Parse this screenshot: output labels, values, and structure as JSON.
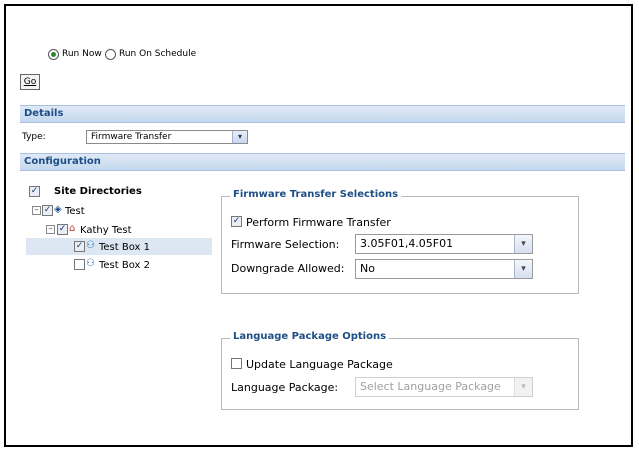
{
  "schedule": {
    "run_now": "Run Now",
    "run_on_schedule": "Run On Schedule",
    "selected": "run_now"
  },
  "go_button": "Go",
  "details": {
    "header": "Details",
    "type_label": "Type:",
    "type_value": "Firmware Transfer"
  },
  "configuration": {
    "header": "Configuration"
  },
  "tree": {
    "root": "Site Directories",
    "items": [
      {
        "label": "Test",
        "checked": true
      },
      {
        "label": "Kathy Test",
        "checked": true
      },
      {
        "label": "Test Box 1",
        "checked": true,
        "selected": true
      },
      {
        "label": "Test Box 2",
        "checked": false
      }
    ]
  },
  "firmware": {
    "legend": "Firmware Transfer Selections",
    "perform_label": "Perform Firmware Transfer",
    "perform_checked": true,
    "selection_label": "Firmware Selection:",
    "selection_value": "3.05F01,4.05F01",
    "downgrade_label": "Downgrade Allowed:",
    "downgrade_value": "No"
  },
  "language": {
    "legend": "Language Package Options",
    "update_label": "Update Language Package",
    "update_checked": false,
    "package_label": "Language Package:",
    "package_placeholder": "Select Language Package"
  },
  "colors": {
    "accent": "#1d4e86",
    "section_bg": "#c6d8ee",
    "radio_selected": "#2a8a2a",
    "tree_selected_bg": "#dde6f3"
  }
}
